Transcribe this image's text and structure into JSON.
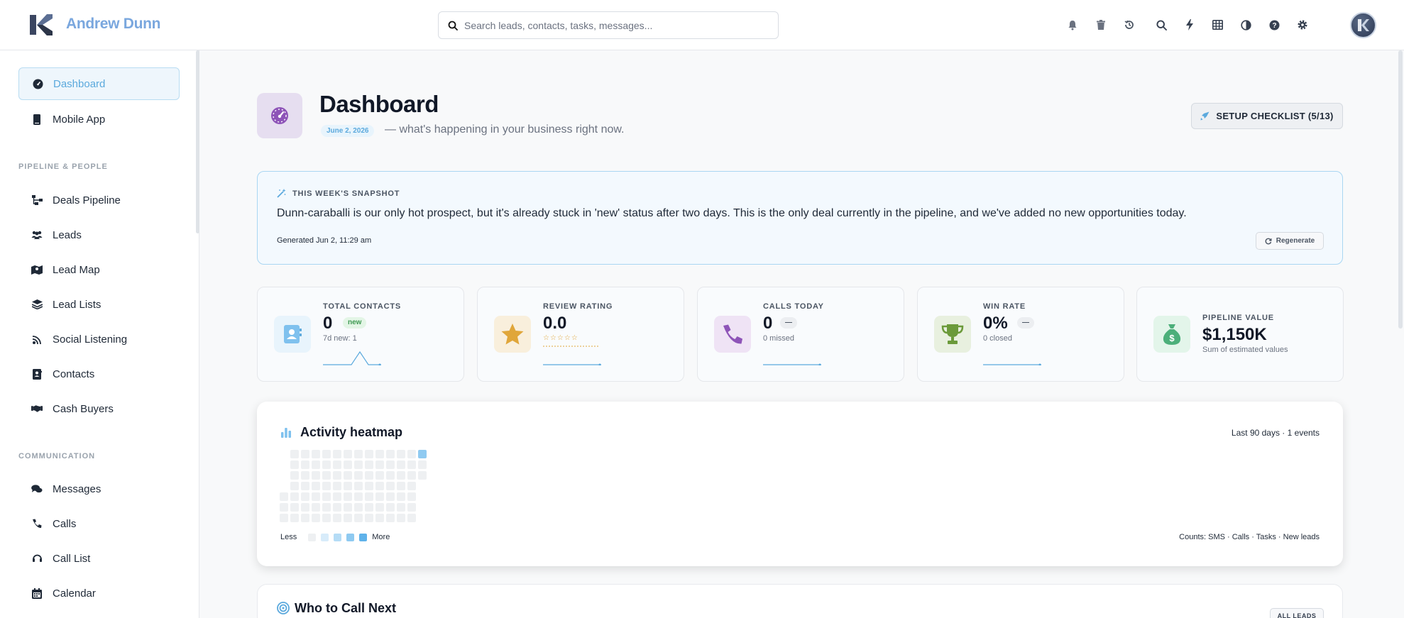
{
  "app": {
    "user_name": "Andrew Dunn",
    "search_placeholder": "Search leads, contacts, tasks, messages..."
  },
  "topbar": {
    "icons": [
      "bell-icon",
      "trash-icon",
      "history-icon",
      "search-icon",
      "bolt-icon",
      "table-icon",
      "contrast-icon",
      "help-icon",
      "gear-icon"
    ]
  },
  "sidebar": {
    "items": [
      {
        "label": "Dashboard",
        "icon": "gauge-icon",
        "active": true
      },
      {
        "label": "Mobile App",
        "icon": "mobile-icon"
      }
    ],
    "section_pipeline": "PIPELINE & PEOPLE",
    "pipeline_items": [
      {
        "label": "Deals Pipeline",
        "icon": "sitemap-icon"
      },
      {
        "label": "Leads",
        "icon": "users-icon"
      },
      {
        "label": "Lead Map",
        "icon": "map-icon"
      },
      {
        "label": "Lead Lists",
        "icon": "layers-icon"
      },
      {
        "label": "Social Listening",
        "icon": "signal-icon"
      },
      {
        "label": "Contacts",
        "icon": "contact-card-icon"
      },
      {
        "label": "Cash Buyers",
        "icon": "handshake-icon"
      }
    ],
    "section_communication": "COMMUNICATION",
    "communication_items": [
      {
        "label": "Messages",
        "icon": "chat-icon"
      },
      {
        "label": "Calls",
        "icon": "phone-icon"
      },
      {
        "label": "Call List",
        "icon": "headset-icon"
      },
      {
        "label": "Calendar",
        "icon": "calendar-icon"
      }
    ]
  },
  "header": {
    "title": "Dashboard",
    "date": "June 2, 2026",
    "subtitle": "— what's happening in your business right now.",
    "setup_label": "SETUP CHECKLIST (5/13)"
  },
  "snapshot": {
    "label": "THIS WEEK'S SNAPSHOT",
    "text": "Dunn-caraballi is our only hot prospect, but it's already stuck in 'new' status after two days. This is the only deal currently in the pipeline, and we've added no new opportunities today.",
    "generated": "Generated Jun 2, 11:29 am",
    "regenerate_label": "Regenerate"
  },
  "stats": [
    {
      "label": "TOTAL CONTACTS",
      "value": "0",
      "badge": "new",
      "sub": "7d new: 1",
      "color": "#5ba9dd"
    },
    {
      "label": "REVIEW RATING",
      "value": "0.0",
      "stars": "☆☆☆☆☆",
      "color": "#e0a63a"
    },
    {
      "label": "CALLS TODAY",
      "value": "0",
      "badge": "—",
      "sub": "0 missed",
      "color": "#8e54b8"
    },
    {
      "label": "WIN RATE",
      "value": "0%",
      "badge": "—",
      "sub": "0 closed",
      "color": "#6b9a3a"
    },
    {
      "label": "PIPELINE VALUE",
      "value": "$1,150K",
      "sub": "Sum of estimated values",
      "color": "#4caf7a"
    }
  ],
  "heatmap": {
    "title": "Activity heatmap",
    "meta": "Last 90 days · 1 events",
    "legend_less": "Less",
    "legend_more": "More",
    "counts": "Counts: SMS · Calls · Tasks · New leads",
    "legend_colors": [
      "#eef0f2",
      "#d8ecfa",
      "#b5dcf6",
      "#8fcaf1",
      "#5fb2ea"
    ],
    "active_color": "#8fcaf1"
  },
  "who_to_call": {
    "title": "Who to Call Next",
    "button_label": "ALL LEADS"
  }
}
